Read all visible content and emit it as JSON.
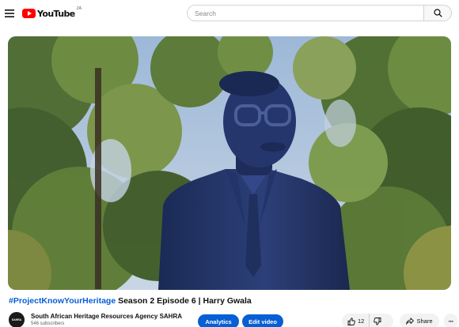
{
  "header": {
    "logo_text": "YouTube",
    "region_code": "ZA",
    "search_placeholder": "Search"
  },
  "video": {
    "title_hashtag": "#ProjectKnowYourHeritage",
    "title_rest": " Season 2 Episode 6 | Harry Gwala"
  },
  "channel": {
    "name": "South African Heritage Resources Agency SAHRA",
    "subscribers": "546 subscribers",
    "avatar_text": "SAHRA"
  },
  "actions": {
    "analytics_label": "Analytics",
    "edit_label": "Edit video",
    "like_count": "12",
    "share_label": "Share",
    "more_label": "···"
  },
  "colors": {
    "brand_red": "#ff0000",
    "link_blue": "#065fd4",
    "pill_gray": "#f2f2f2"
  },
  "icons": [
    "menu-icon",
    "youtube-logo-icon",
    "search-icon",
    "like-icon",
    "dislike-icon",
    "share-icon",
    "more-icon"
  ]
}
